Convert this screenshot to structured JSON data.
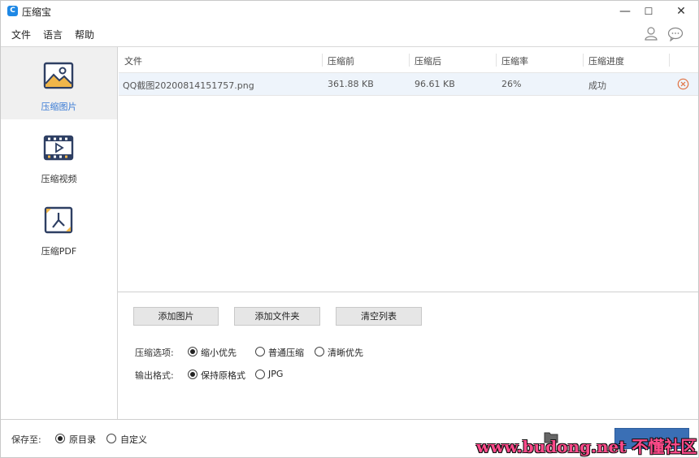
{
  "app": {
    "title": "压缩宝",
    "icon_letter": "C",
    "accent_color": "#3a7bd5"
  },
  "window_controls": {
    "minimize": "—",
    "maximize": "☐",
    "close": "✕"
  },
  "menu": {
    "items": [
      {
        "label": "文件"
      },
      {
        "label": "语言"
      },
      {
        "label": "帮助"
      }
    ],
    "user_icon": "user-icon",
    "chat_icon": "chat-icon"
  },
  "sidebar": {
    "items": [
      {
        "label": "压缩图片",
        "icon": "image-icon",
        "active": true
      },
      {
        "label": "压缩视频",
        "icon": "video-icon",
        "active": false
      },
      {
        "label": "压缩PDF",
        "icon": "pdf-icon",
        "active": false
      }
    ]
  },
  "table": {
    "headers": [
      "文件",
      "压缩前",
      "压缩后",
      "压缩率",
      "压缩进度"
    ],
    "rows": [
      {
        "file": "QQ截图20200814151757.png",
        "before": "361.88 KB",
        "after": "96.61 KB",
        "rate": "26%",
        "progress": "成功"
      }
    ]
  },
  "actions": {
    "add_image": "添加图片",
    "add_folder": "添加文件夹",
    "clear_list": "清空列表"
  },
  "compress_options": {
    "label": "压缩选项:",
    "options": [
      "缩小优先",
      "普通压缩",
      "清晰优先"
    ],
    "selected": "缩小优先"
  },
  "output_format": {
    "label": "输出格式:",
    "options": [
      "保持原格式",
      "JPG"
    ],
    "selected": "保持原格式"
  },
  "save_to": {
    "label": "保存至:",
    "options": [
      "原目录",
      "自定义"
    ],
    "selected": "原目录"
  },
  "watermark": {
    "text": "www.budong.net 不懂社区"
  }
}
